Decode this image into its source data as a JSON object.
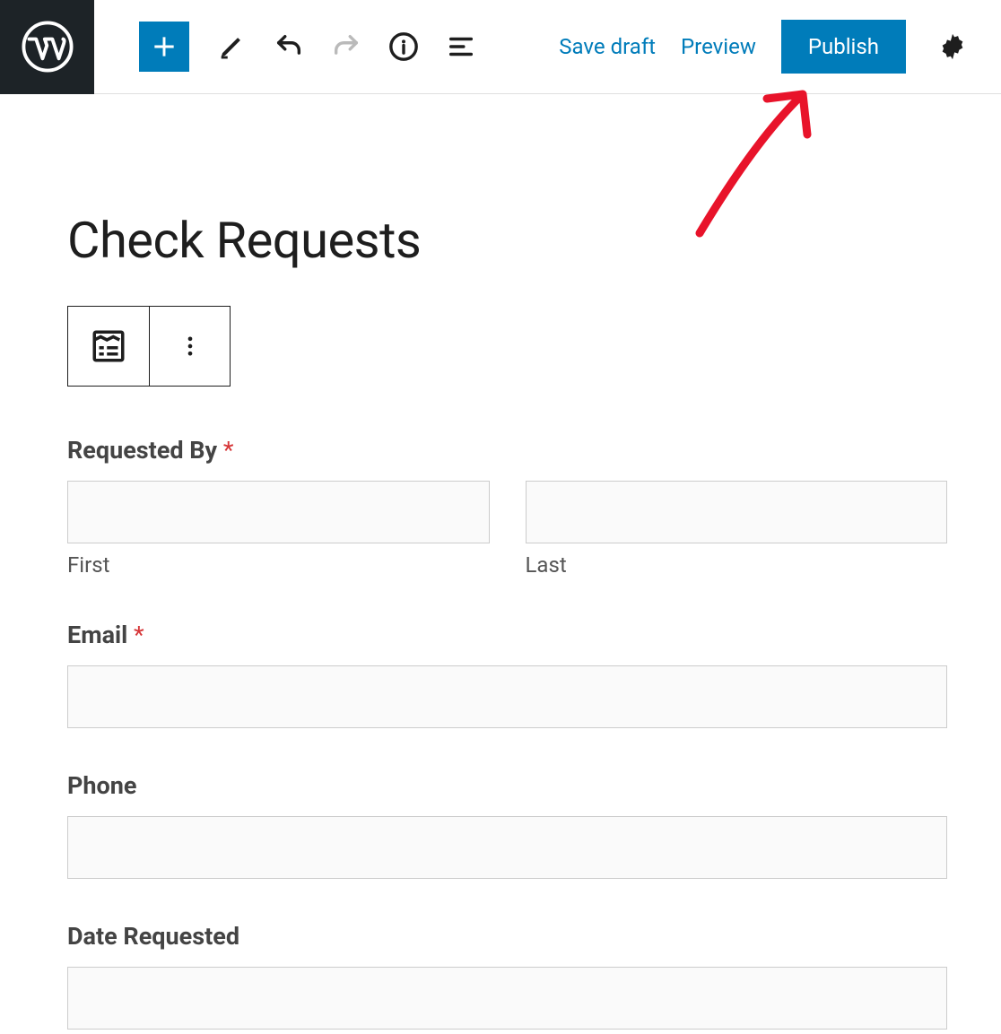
{
  "toolbar": {
    "save_draft": "Save draft",
    "preview": "Preview",
    "publish": "Publish"
  },
  "page": {
    "title": "Check Requests"
  },
  "form": {
    "requested_by": {
      "label": "Requested By",
      "first_sub": "First",
      "last_sub": "Last"
    },
    "email": {
      "label": "Email"
    },
    "phone": {
      "label": "Phone"
    },
    "date_requested": {
      "label": "Date Requested"
    }
  },
  "colors": {
    "accent": "#007cba",
    "required": "#d63638"
  }
}
